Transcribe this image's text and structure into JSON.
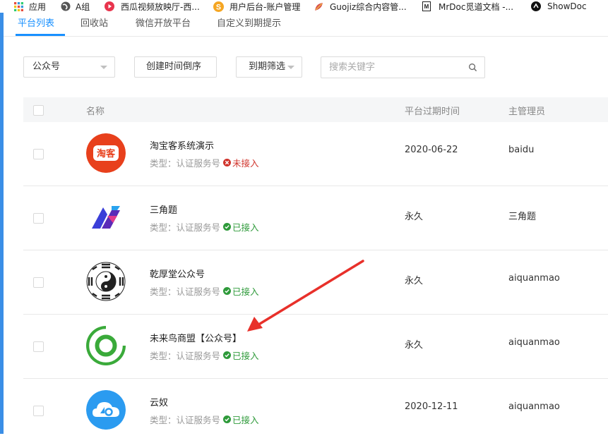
{
  "bookmarks": [
    {
      "label": "应用",
      "icon": "apps-grid-icon",
      "color": "#e74c3c"
    },
    {
      "label": "A组",
      "icon": "globe-icon",
      "color": "#444444"
    },
    {
      "label": "西瓜视频放映厅-西...",
      "icon": "play-icon",
      "color": "#e8344d"
    },
    {
      "label": "用户后台-账户管理",
      "icon": "s-icon",
      "color": "#f5a623"
    },
    {
      "label": "Guojiz综合内容管...",
      "icon": "leaf-icon",
      "color": "#d9534f"
    },
    {
      "label": "MrDoc觅道文档 -...",
      "icon": "doc-icon",
      "color": "#222222"
    },
    {
      "label": "ShowDoc",
      "icon": "showdoc-icon",
      "color": "#111111"
    }
  ],
  "tabs": [
    {
      "label": "平台列表",
      "active": true
    },
    {
      "label": "回收站",
      "active": false
    },
    {
      "label": "微信开放平台",
      "active": false
    },
    {
      "label": "自定义到期提示",
      "active": false
    }
  ],
  "filters": {
    "type": "公众号",
    "sort": "创建时间倒序",
    "expire": "到期筛选",
    "search_placeholder": "搜索关键字"
  },
  "table": {
    "headers": {
      "name": "名称",
      "expire": "平台过期时间",
      "admin": "主管理员"
    },
    "rows": [
      {
        "name": "淘宝客系统演示",
        "type": "类型：认证服务号",
        "status": "未接入",
        "status_ok": false,
        "expire": "2020-06-22",
        "admin": "baidu",
        "logo": "taoke-logo"
      },
      {
        "name": "三角题",
        "type": "类型：认证服务号",
        "status": "已接入",
        "status_ok": true,
        "expire": "永久",
        "admin": "三角题",
        "logo": "triangle-logo"
      },
      {
        "name": "乾厚堂公众号",
        "type": "类型：认证服务号",
        "status": "已接入",
        "status_ok": true,
        "expire": "永久",
        "admin": "aiquanmao",
        "logo": "taiji-logo"
      },
      {
        "name": "未来鸟商盟【公众号】",
        "type": "类型：认证服务号",
        "status": "已接入",
        "status_ok": true,
        "expire": "永久",
        "admin": "aiquanmao",
        "logo": "ring-logo"
      },
      {
        "name": "云奴",
        "type": "类型：认证服务号",
        "status": "已接入",
        "status_ok": true,
        "expire": "2020-12-11",
        "admin": "aiquanmao",
        "logo": "cloud-logo"
      }
    ]
  },
  "colors": {
    "accent": "#1890ff",
    "ok": "#2e9a3a",
    "bad": "#d0342c",
    "annotation": "#e8302a"
  }
}
